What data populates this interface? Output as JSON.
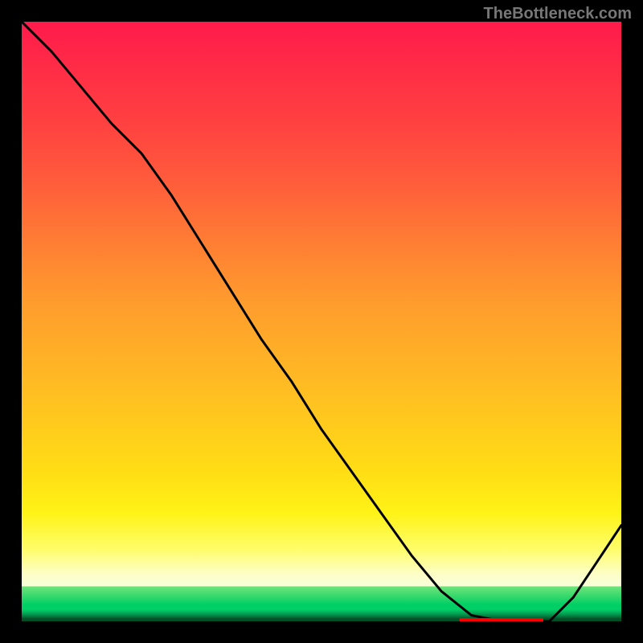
{
  "watermark": "TheBottleneck.com",
  "chart_data": {
    "type": "line",
    "title": "",
    "xlabel": "",
    "ylabel": "",
    "xlim": [
      0,
      100
    ],
    "ylim": [
      0,
      100
    ],
    "grid": false,
    "series": [
      {
        "name": "curve",
        "x": [
          0,
          5,
          10,
          15,
          20,
          25,
          30,
          35,
          40,
          45,
          50,
          55,
          60,
          65,
          70,
          75,
          80,
          85,
          88,
          92,
          96,
          100
        ],
        "y": [
          100,
          95,
          89,
          83,
          78,
          71,
          63,
          55,
          47,
          40,
          32,
          25,
          18,
          11,
          5,
          1,
          0,
          0,
          0,
          4,
          10,
          16
        ]
      }
    ],
    "annotations": [
      {
        "name": "optimum-marker",
        "x_start": 73,
        "x_end": 87,
        "y": 0,
        "color": "#ff0000"
      }
    ],
    "background": {
      "type": "vertical-gradient",
      "stops": [
        {
          "pos": 0.0,
          "color": "#ff1a4b"
        },
        {
          "pos": 0.36,
          "color": "#ff7b34"
        },
        {
          "pos": 0.66,
          "color": "#ffc81e"
        },
        {
          "pos": 0.88,
          "color": "#fffd6a"
        },
        {
          "pos": 0.95,
          "color": "#6fe47a"
        },
        {
          "pos": 1.0,
          "color": "#004f27"
        }
      ]
    }
  }
}
